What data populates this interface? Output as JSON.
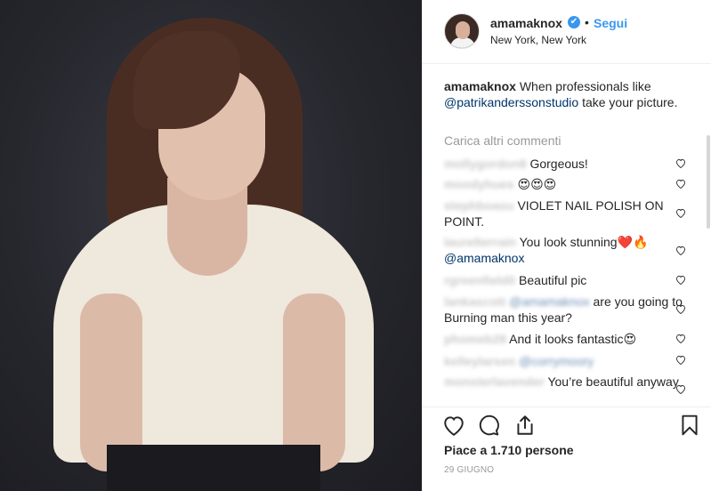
{
  "header": {
    "username": "amamaknox",
    "verified_mark": "✔",
    "separator": "•",
    "follow_label": "Segui",
    "location": "New York, New York"
  },
  "caption": {
    "username": "amamaknox",
    "text_before": " When professionals like ",
    "mention": "@patrikanderssonstudio",
    "text_after": " take your picture."
  },
  "load_more_label": "Carica altri commenti",
  "comments": [
    {
      "user": "mollygordon8",
      "text": "Gorgeous!"
    },
    {
      "user": "moodyhues",
      "text": "😍😍😍"
    },
    {
      "user": "stephboasu",
      "text": "VIOLET NAIL POLISH ON POINT."
    },
    {
      "user": "laurelterrain",
      "text": "You look stunning❤️🔥 ",
      "mention": "@amamaknox"
    },
    {
      "user": "rgreenfield0",
      "text": "Beautiful pic"
    },
    {
      "user": "lankascott",
      "blur_mention": "@amamaknox",
      "text": " are you going to Burning man this year?"
    },
    {
      "user": "phomeb28",
      "text": "And it looks fantastic😍"
    },
    {
      "user": "kelleylarsen",
      "blur_mention": "@corrymoory",
      "text": ""
    },
    {
      "user": "monsterlavender",
      "text": "You’re beautiful anyway"
    }
  ],
  "actions": {
    "icons": [
      "heart-icon",
      "comment-icon",
      "share-icon",
      "bookmark-icon"
    ],
    "likes_text": "Piace a 1.710 persone",
    "date": "29 GIUGNO"
  },
  "colors": {
    "link": "#3897f0",
    "mention": "#003569",
    "muted": "#999999",
    "text": "#262626"
  }
}
